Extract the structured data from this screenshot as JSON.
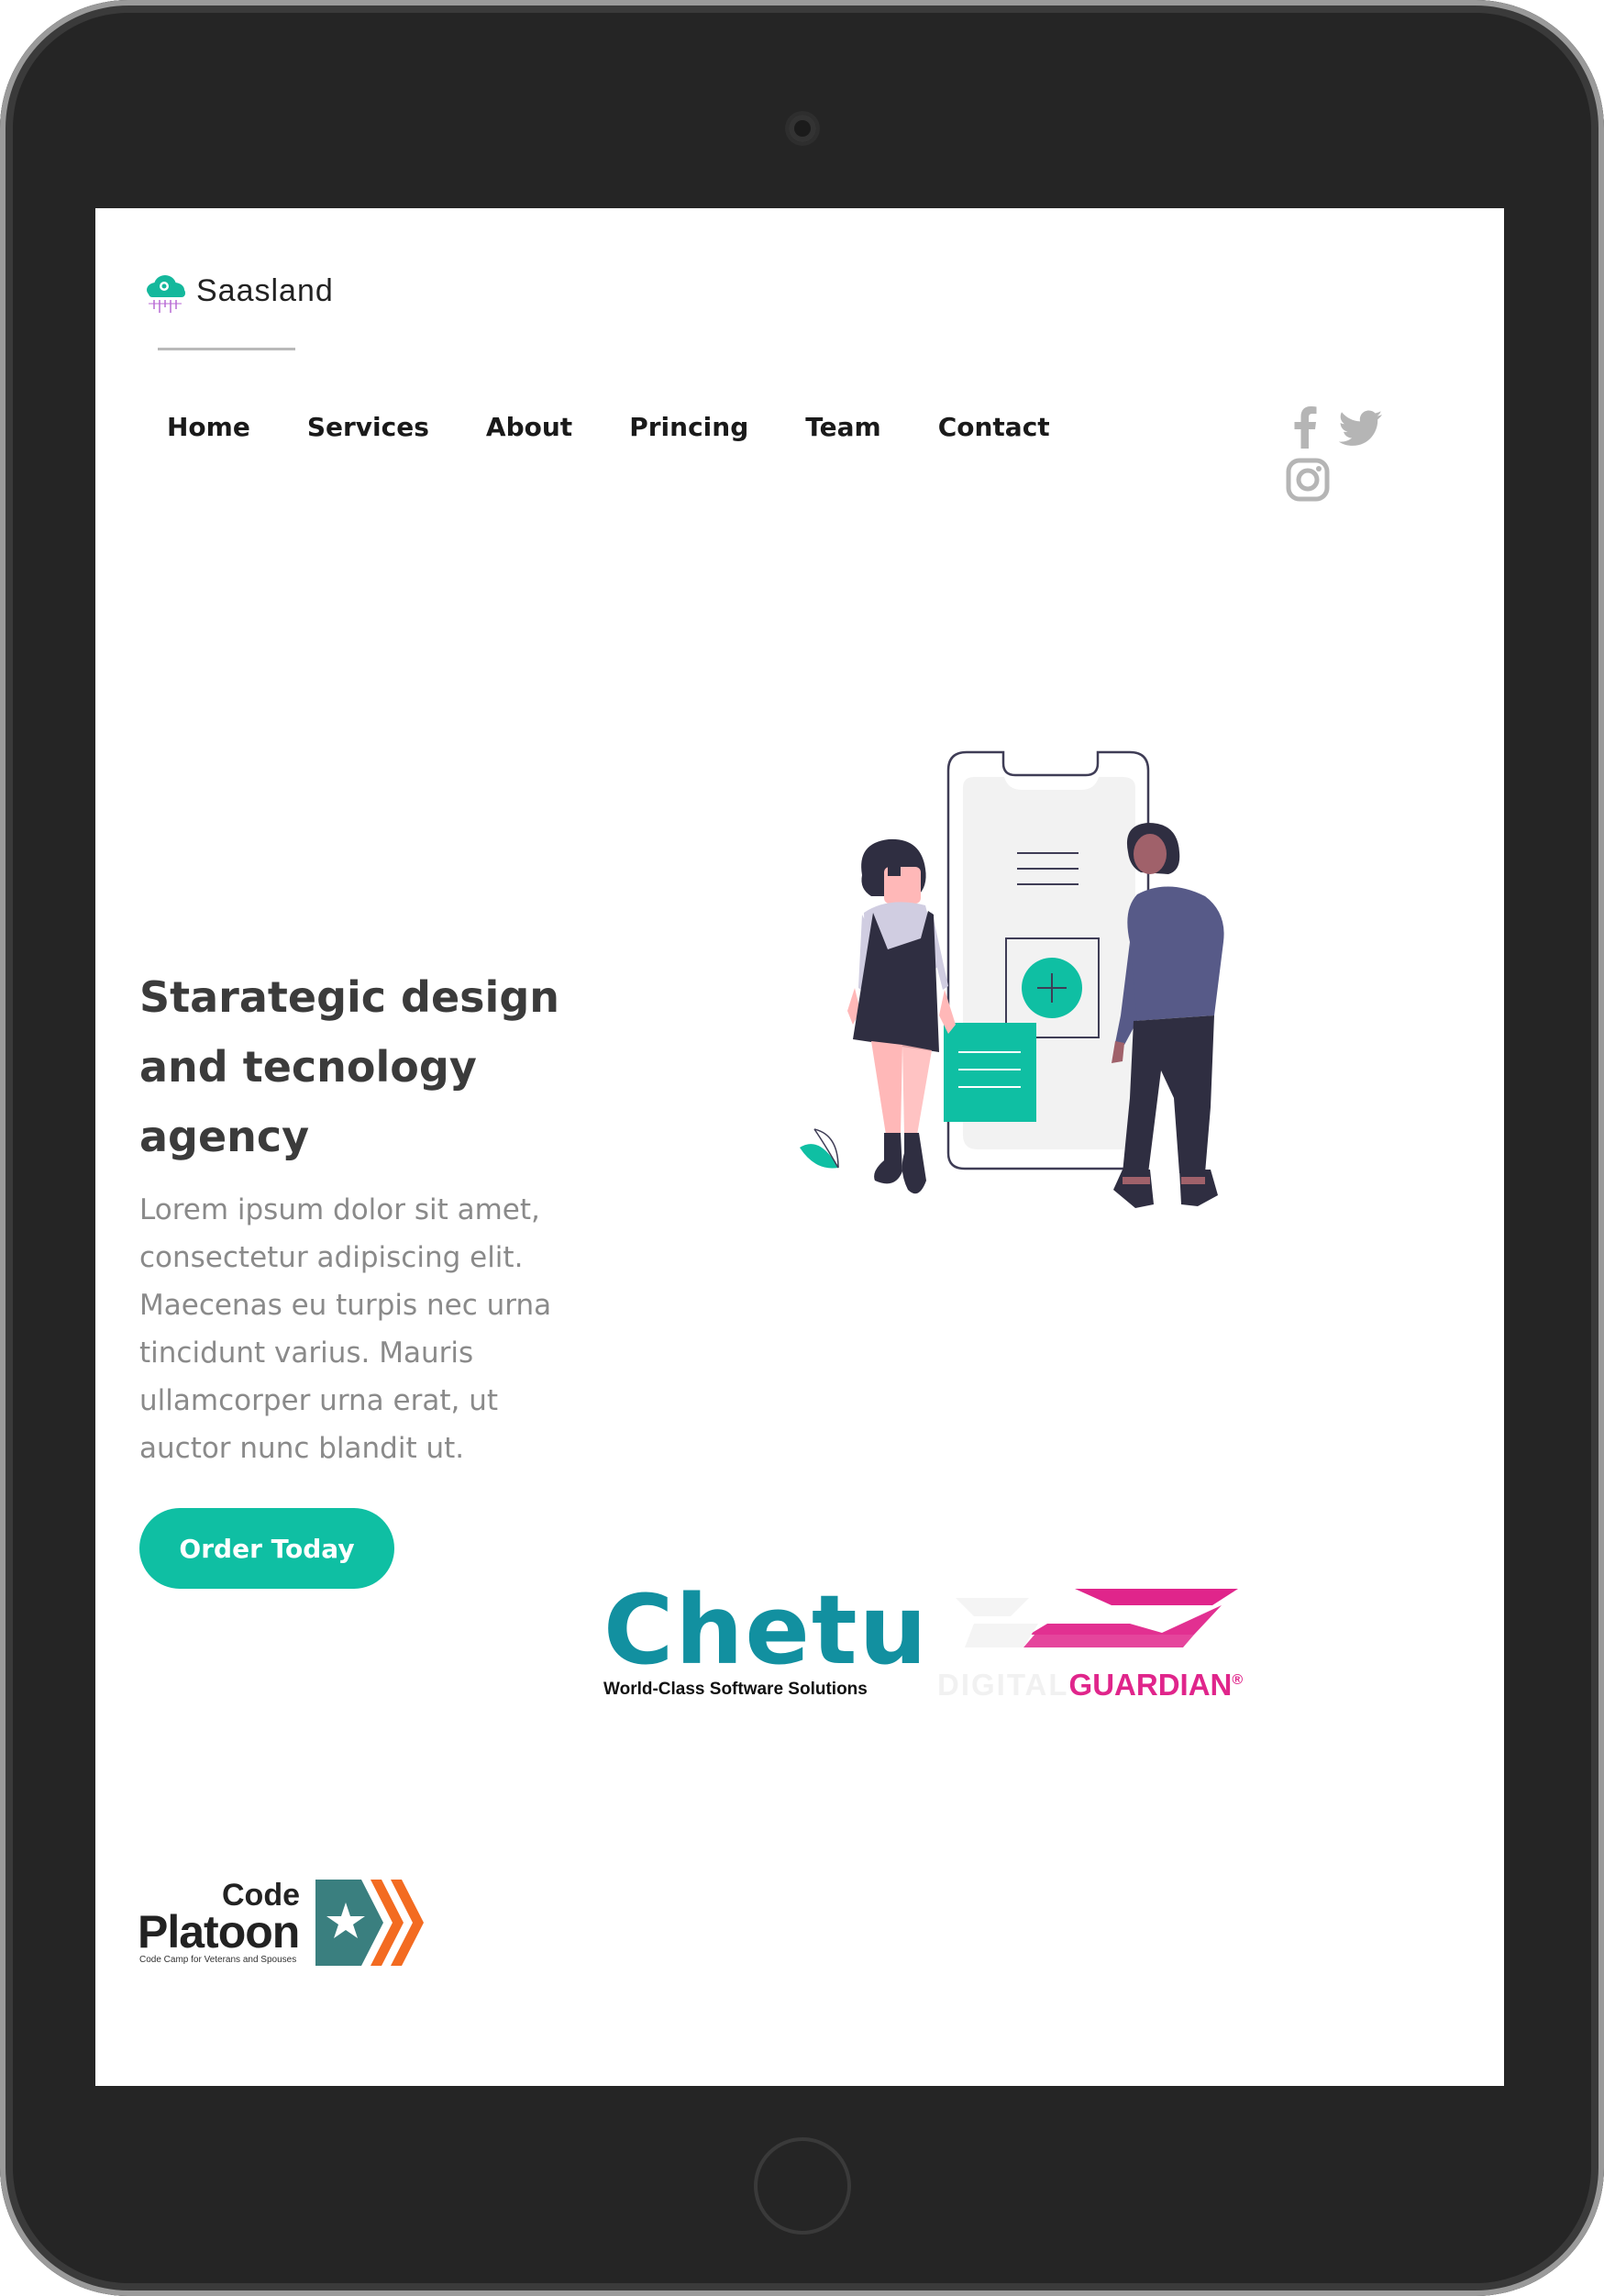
{
  "brand": {
    "name": "Saasland"
  },
  "nav": {
    "items": [
      {
        "label": "Home"
      },
      {
        "label": "Services"
      },
      {
        "label": "About"
      },
      {
        "label": "Princing"
      },
      {
        "label": "Team"
      },
      {
        "label": "Contact"
      }
    ]
  },
  "social": {
    "icons": [
      "facebook-icon",
      "twitter-icon",
      "instagram-icon"
    ],
    "color": "#b5b5b5"
  },
  "hero": {
    "headline": "Starategic design and tecnology agency",
    "body": "Lorem ipsum dolor sit amet, consectetur adipiscing elit. Maecenas eu turpis nec urna tincidunt varius. Mauris ullamcorper urna erat, ut auctor nunc blandit ut.",
    "cta_label": "Order Today"
  },
  "clients": {
    "chetu": {
      "name": "Chetu",
      "tagline": "World-Class Software Solutions"
    },
    "digital_guardian": {
      "word1": "DIGITAL",
      "word2": "GUARDIAN",
      "mark": "®"
    },
    "code_platoon": {
      "word1": "Code",
      "word2": "Platoon",
      "tagline": "Code Camp for Veterans and Spouses"
    }
  },
  "colors": {
    "accent": "#0fbfa3",
    "heading": "#3b3b3b",
    "body_text": "#8a8a8a",
    "frame": "#252525",
    "chetu_blue": "#1290a0",
    "guardian_pink": "#e0258b",
    "platoon_teal": "#3a7f7f",
    "platoon_orange": "#f36b21"
  }
}
